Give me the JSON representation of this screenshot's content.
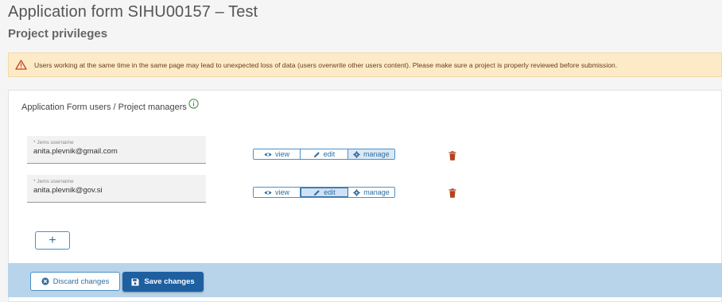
{
  "header": {
    "title": "Application form SIHU00157 – Test",
    "subtitle": "Project privileges"
  },
  "warning": {
    "icon": "warning-triangle-icon",
    "text": "Users working at the same time in the same page may lead to unexpected loss of data (users overwrite other users content). Please make sure a project is properly reviewed before submission."
  },
  "section": {
    "title": "Application Form users / Project managers",
    "info_icon": "info-icon"
  },
  "users": [
    {
      "field_label": "* Jems username",
      "username": "anita.plevnik@gmail.com",
      "permission": "manage"
    },
    {
      "field_label": "* Jems username",
      "username": "anita.plevnik@gov.si",
      "permission": "edit"
    }
  ],
  "permissions": {
    "view_label": "view",
    "edit_label": "edit",
    "manage_label": "manage"
  },
  "add_button": {
    "label": "+"
  },
  "footer": {
    "discard_label": "Discard changes",
    "save_label": "Save changes"
  },
  "colors": {
    "accent": "#2f6fa3",
    "primary_button": "#1e5fa0",
    "footer_bg": "#b8d4ea",
    "warning_bg": "#fdebc8",
    "trash": "#b5421e"
  }
}
